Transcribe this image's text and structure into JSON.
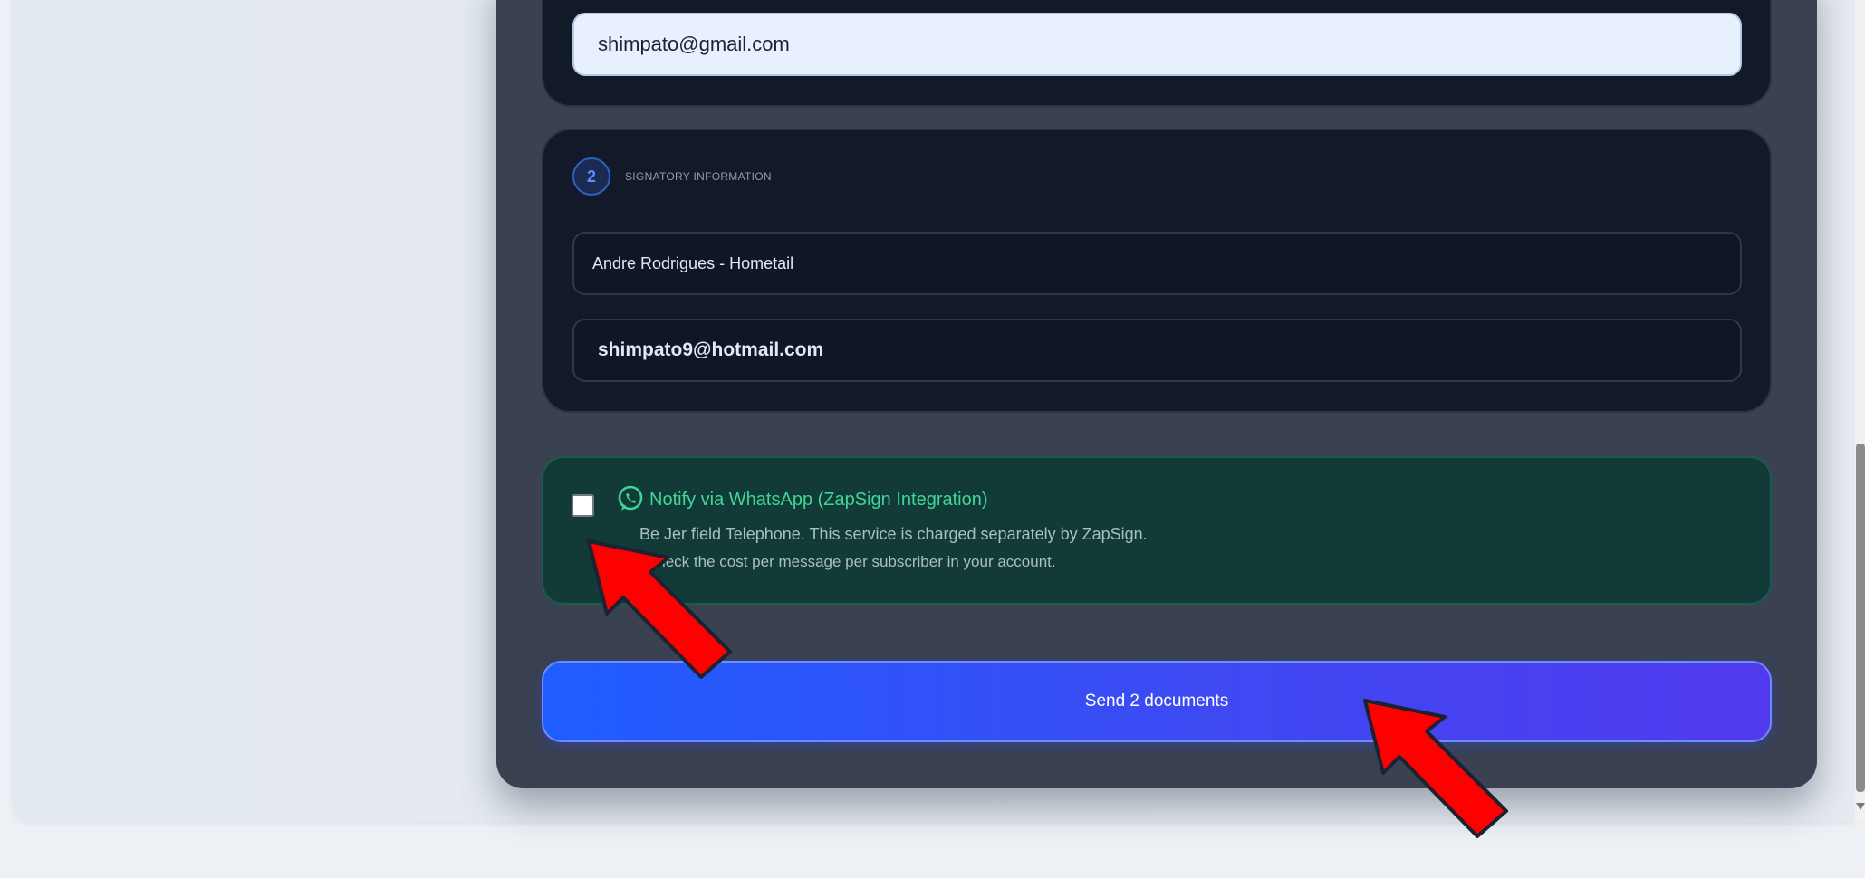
{
  "sender": {
    "email_value": "shimpato@gmail.com"
  },
  "signatory": {
    "step_number": "2",
    "section_label": "SIGNATORY INFORMATION",
    "name_value": "Andre Rodrigues - Hometail",
    "email_value": "shimpato9@hotmail.com"
  },
  "whatsapp": {
    "title": "Notify via WhatsApp (ZapSign Integration)",
    "description_line1": "Be Jer field Telephone. This service is charged separately by ZapSign.",
    "description_line2": "Check the cost per message per subscriber in your account.",
    "checked": false,
    "accent_color": "#3fd69b",
    "icon": "whatsapp-icon"
  },
  "actions": {
    "send_label": "Send 2 documents"
  },
  "colors": {
    "panel": "#3a4150",
    "card": "#121a2a",
    "button_start": "#1f5dff",
    "button_end": "#5139ee",
    "annotation_arrow": "#ff0000"
  }
}
